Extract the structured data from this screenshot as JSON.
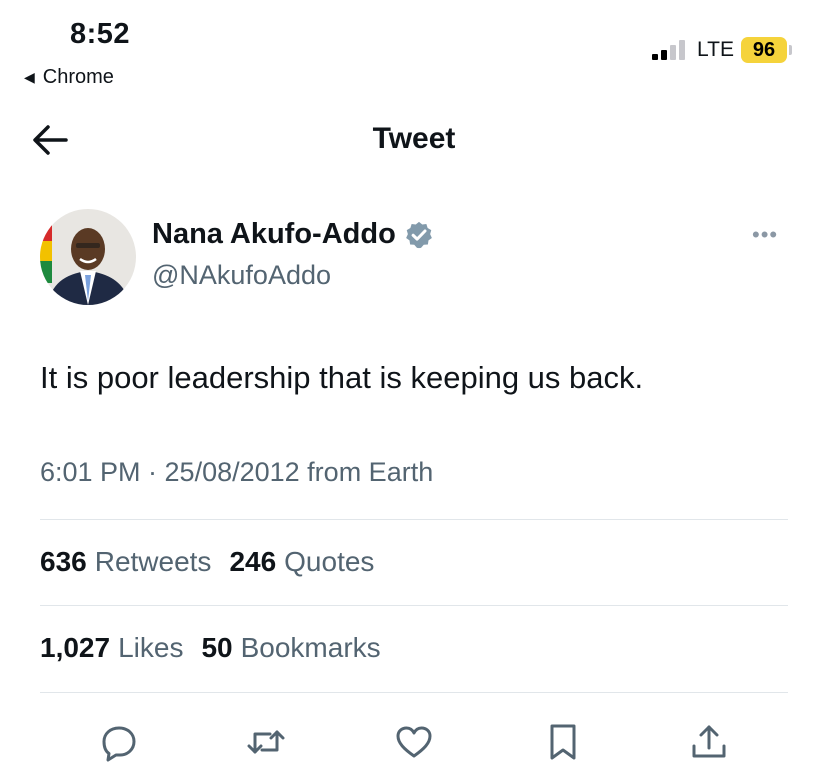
{
  "status_bar": {
    "time": "8:52",
    "back_app": "Chrome",
    "network": "LTE",
    "battery": "96",
    "battery_color": "#f5d33b"
  },
  "header": {
    "title": "Tweet"
  },
  "author": {
    "name": "Nana Akufo-Addo",
    "handle": "@NAkufoAddo",
    "verified_color": "#829aab",
    "more": "•••"
  },
  "tweet": {
    "text": "It is poor leadership that is keeping us back.",
    "meta": "6:01 PM · 25/08/2012 from Earth"
  },
  "stats": {
    "retweets_count": "636",
    "retweets_label": "Retweets",
    "quotes_count": "246",
    "quotes_label": "Quotes",
    "likes_count": "1,027",
    "likes_label": "Likes",
    "bookmarks_count": "50",
    "bookmarks_label": "Bookmarks"
  },
  "actions": [
    "reply-icon",
    "retweet-icon",
    "like-icon",
    "bookmark-icon",
    "share-icon"
  ]
}
